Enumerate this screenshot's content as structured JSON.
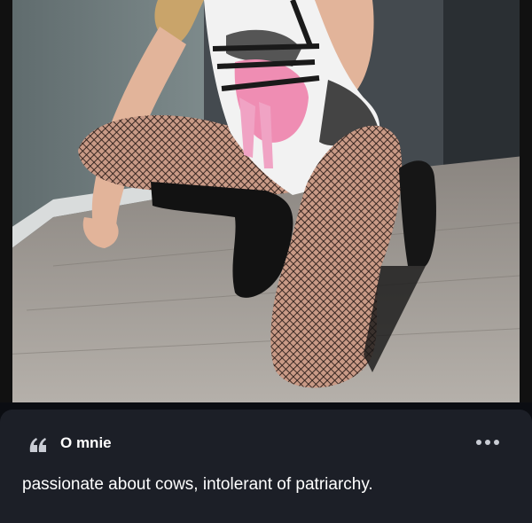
{
  "prompt": {
    "title": "O mnie",
    "answer": "passionate about cows, intolerant of patriarchy.",
    "quote_icon": "quote-icon",
    "more_icon": "more-options-icon"
  },
  "colors": {
    "background": "#0b0d12",
    "card": "#1c1f27",
    "text": "#ffffff"
  }
}
